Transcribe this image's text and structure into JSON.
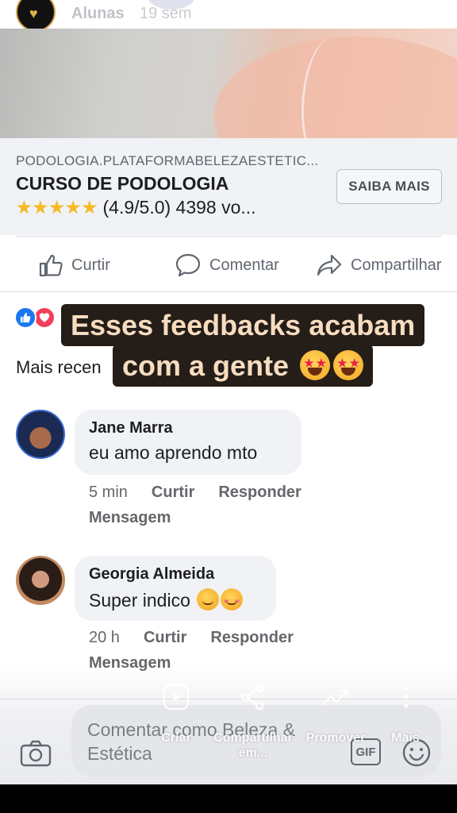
{
  "top": {
    "username": "Alunas",
    "time": "19 sem"
  },
  "ad": {
    "domain": "PODOLOGIA.PLATAFORMABELEZAESTETIC...",
    "title": "CURSO DE PODOLOGIA",
    "stars": "★★★★★",
    "rating_text": " (4.9/5.0) 4398 vo...",
    "cta": "SAIBA MAIS"
  },
  "actions": {
    "like": "Curtir",
    "comment": "Comentar",
    "share": "Compartilhar"
  },
  "sort_label": "Mais recen",
  "overlay": {
    "line1": "Esses feedbacks acabam",
    "line2": "com a gente"
  },
  "comments": [
    {
      "name": "Jane Marra",
      "text": "eu amo  aprendo mto",
      "time": "5 min",
      "like": "Curtir",
      "reply": "Responder",
      "message": "Mensagem"
    },
    {
      "name": "Georgia Almeida",
      "text": "Super indico",
      "time": "20 h",
      "like": "Curtir",
      "reply": "Responder",
      "message": "Mensagem"
    }
  ],
  "composer": {
    "placeholder": "Comentar como Beleza & Estética",
    "gif": "GIF"
  },
  "story_toolbar": {
    "create": "Criar",
    "share": "Compartilhar em...",
    "promote": "Promover",
    "more": "Mais"
  },
  "colors": {
    "like_blue": "#1877f2",
    "love_red": "#f33e58",
    "caption_bg": "#241d18",
    "caption_text": "#f7dcc0",
    "star_gold": "#f7b928"
  }
}
